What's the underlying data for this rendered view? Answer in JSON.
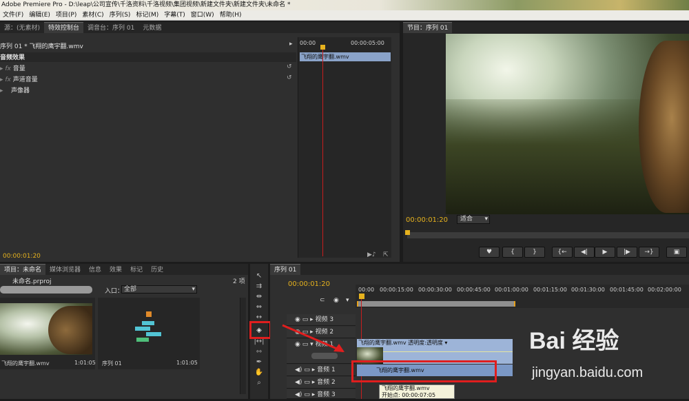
{
  "app": {
    "title": "Adobe Premiere Pro - D:\\leap\\公司宣传\\千洛资料\\千洛视频\\集团视频\\新建文件夹\\新建文件夹\\未命名 *"
  },
  "menu": [
    "文件(F)",
    "编辑(E)",
    "项目(P)",
    "素材(C)",
    "序列(S)",
    "标记(M)",
    "字幕(T)",
    "窗口(W)",
    "帮助(H)"
  ],
  "source_panel": {
    "tabs": [
      "源：(无素材)",
      "特效控制台",
      "调音台：序列 01",
      "元数据"
    ],
    "sequence_label": "序列 01 * 飞翔的鹰宇翻.wmv",
    "section": "音频效果",
    "effects": [
      "音量",
      "声道音量",
      "声像器"
    ],
    "time_start": "00:00",
    "time_end": "00:00:05:00",
    "clip_name": "飞翔的鹰宇翻.wmv",
    "timecode": "00:00:01:20"
  },
  "program_panel": {
    "tab": "节目：序列 01",
    "timecode": "00:00:01:20",
    "zoom": "适合"
  },
  "project_panel": {
    "tabs": [
      "项目：未命名",
      "媒体浏览器",
      "信息",
      "效果",
      "标记",
      "历史"
    ],
    "item_count": "2 项",
    "project_file": "未命名.prproj",
    "in_label": "入口：",
    "in_value": "全部",
    "items": [
      {
        "name": "飞翔的鹰宇翻.wmv",
        "duration": "1:01:05"
      },
      {
        "name": "序列 01",
        "duration": "1:01:05"
      }
    ]
  },
  "timeline": {
    "tab": "序列 01",
    "timecode": "00:00:01:20",
    "ruler": [
      "00:00",
      "00:00:15:00",
      "00:00:30:00",
      "00:00:45:00",
      "00:01:00:00",
      "00:01:15:00",
      "00:01:30:00",
      "00:01:45:00",
      "00:02:00:00"
    ],
    "tracks": [
      "视频 3",
      "视频 2",
      "视频 1",
      "音频 1",
      "音频 2",
      "音频 3"
    ],
    "video_clip": "飞翔的鹰宇翻.wmv",
    "video_clip_effect": "透明度:透明度",
    "audio_clip": "飞翔的鹰宇翻.wmv",
    "tooltip_name": "飞翔的鹰宇翻.wmv",
    "tooltip_start": "开始点: 00:00:07:05"
  },
  "watermark": {
    "brand": "Bai 经验",
    "url": "jingyan.baidu.com"
  },
  "colors": {
    "timecode": "#e6b21e",
    "playhead": "#c81e1e",
    "highlight": "#e01e1e",
    "clip": "#8aa3c9"
  }
}
